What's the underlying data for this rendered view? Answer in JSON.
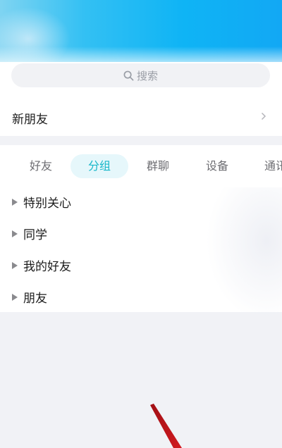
{
  "search": {
    "placeholder": "搜索",
    "icon": "search-icon"
  },
  "new_friends": {
    "label": "新朋友",
    "icon": "chevron-right-icon"
  },
  "tabs": [
    {
      "label": "好友",
      "active": false
    },
    {
      "label": "分组",
      "active": true
    },
    {
      "label": "群聊",
      "active": false
    },
    {
      "label": "设备",
      "active": false
    },
    {
      "label": "通讯",
      "active": false
    }
  ],
  "groups": [
    {
      "name": "特别关心",
      "icon": "expand-triangle-icon"
    },
    {
      "name": "同学",
      "icon": "expand-triangle-icon"
    },
    {
      "name": "我的好友",
      "icon": "expand-triangle-icon"
    },
    {
      "name": "朋友",
      "icon": "expand-triangle-icon"
    }
  ],
  "colors": {
    "accent": "#17b7c9",
    "active_tab_bg": "#e6f7fb",
    "header_blue": "#0fb4f5",
    "annotation_arrow": "#c4161c"
  }
}
